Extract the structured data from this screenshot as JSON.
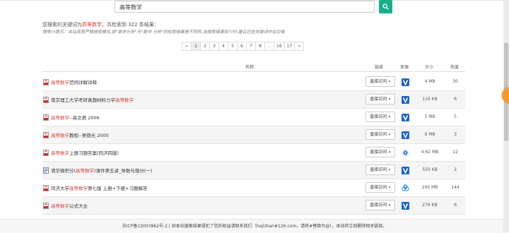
{
  "search": {
    "value": "高等数学"
  },
  "summary": {
    "prefix": "您搜索的关键词为",
    "keyword": "高等数学",
    "suffix": "，共检索到 322 条结果："
  },
  "tip": "搜索小提示：本站采用严格搜索模式,即\"数学分析\"与\"数学 分析\"的检索结果是不同的,当搜索结果较少时,建议您在关键词中加空格",
  "pager": [
    "«",
    "1",
    "2",
    "3",
    "4",
    "5",
    "6",
    "7",
    "8",
    "...",
    "16",
    "17",
    "»"
  ],
  "table": {
    "headers": {
      "name": "名称",
      "link": "链接",
      "source": "来源",
      "size": "大小",
      "hot": "热度"
    },
    "visit_label": "直接访问 »",
    "rows": [
      {
        "pre": "",
        "hl": "高等数学",
        "post": "范例详解详释",
        "icon": "pdf",
        "source": "v",
        "size": "4 MB",
        "hot": "30"
      },
      {
        "pre": "南京理工大学考研真题材料力学",
        "hl": "高等数学",
        "post": "",
        "icon": "pdf",
        "source": "v",
        "size": "116 KB",
        "hot": "6"
      },
      {
        "pre": "",
        "hl": "高等数学",
        "post": "--高文君 2006",
        "icon": "pdf",
        "source": "v",
        "size": "5 MB",
        "hot": "5"
      },
      {
        "pre": "",
        "hl": "高等数学",
        "post": "教程--吴德光 2000",
        "icon": "pdf",
        "source": "v",
        "size": "9 MB",
        "hot": "3"
      },
      {
        "pre": "",
        "hl": "高等数学",
        "post": "上册习题答案(同济四版)",
        "icon": "pdf",
        "source": "disk",
        "size": "4.62 MB",
        "hot": "12"
      },
      {
        "pre": "清华微积分(",
        "hl": "高等数学",
        "post": ")课件第五讲_导数与微分(一)",
        "icon": "doc",
        "source": "v",
        "size": "550 KB",
        "hot": "2"
      },
      {
        "pre": "同济大学",
        "hl": "高等数学",
        "post": "第七版 上册+下册+习题解答",
        "icon": "pdf",
        "source": "baidu",
        "size": "200 MB",
        "hot": "144"
      },
      {
        "pre": "",
        "hl": "高等数学",
        "post": "公式大全",
        "icon": "pdf",
        "source": "v",
        "size": "276 KB",
        "hot": "6"
      }
    ]
  },
  "footer": "苏ICP备13003862号-2 | 如本站搜索结果侵犯了您的权益请联系我们（hejizhan#126.com，请将#替换为@），本站将立刻删除相关链接。",
  "colors": {
    "accent": "#1bae8c",
    "highlight": "#d43f3a",
    "float": "#f39b2b"
  },
  "icons": {
    "search": "search-icon",
    "pdf": "pdf-file-icon",
    "doc": "document-file-icon",
    "v": "v-source-icon",
    "disk": "disk-source-icon",
    "baidu": "baidu-pan-icon"
  }
}
